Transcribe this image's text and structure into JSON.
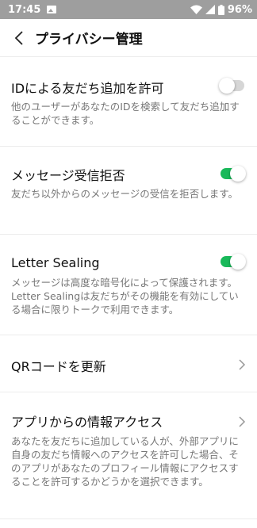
{
  "status_bar": {
    "time": "17:45",
    "battery": "96%"
  },
  "header": {
    "title": "プライバシー管理"
  },
  "settings": [
    {
      "title": "IDによる友だち追加を許可",
      "description": "他のユーザーがあなたのIDを検索して友だち追加することができます。",
      "control": "toggle",
      "enabled": false
    },
    {
      "title": "メッセージ受信拒否",
      "description": "友だち以外からのメッセージの受信を拒否します。",
      "control": "toggle",
      "enabled": true
    },
    {
      "title": "Letter Sealing",
      "description": "メッセージは高度な暗号化によって保護されます。 Letter Sealingは友だちがその機能を有効にしている場合に限りトークで利用できます。",
      "control": "toggle",
      "enabled": true
    },
    {
      "title": "QRコードを更新",
      "control": "chevron"
    },
    {
      "title": "アプリからの情報アクセス",
      "description": "あなたを友だちに追加している人が、外部アプリに自身の友だち情報へのアクセスを許可した場合、そのアプリがあなたのプロフィール情報にアクセスすることを許可するかどうかを選択できます。",
      "control": "chevron"
    }
  ],
  "colors": {
    "toggle_on": "#19b95a",
    "toggle_off": "#d6d6d6",
    "status_bar": "#9e9e9e"
  }
}
